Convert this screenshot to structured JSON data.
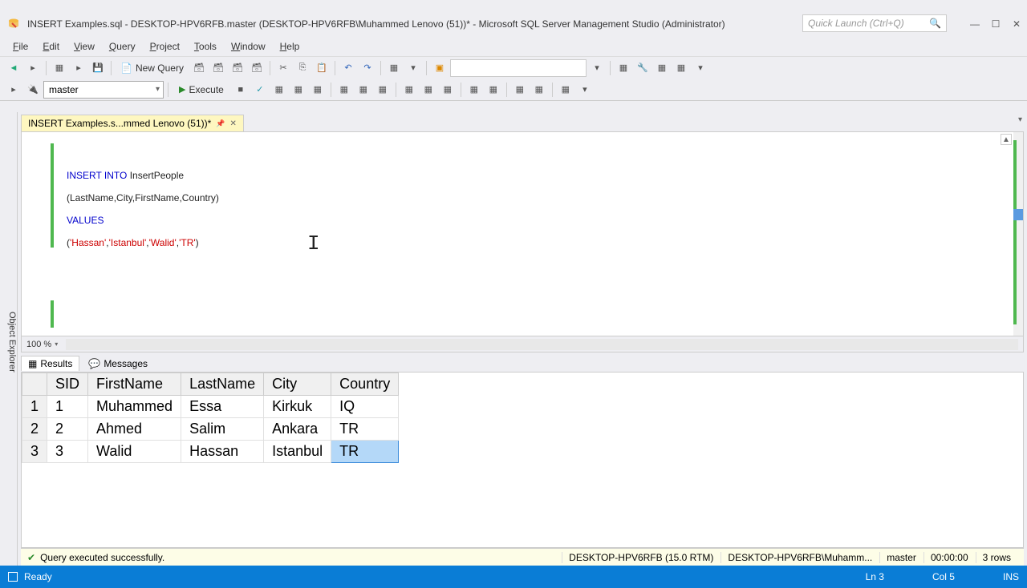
{
  "window": {
    "title": "INSERT Examples.sql - DESKTOP-HPV6RFB.master (DESKTOP-HPV6RFB\\Muhammed Lenovo (51))* - Microsoft SQL Server Management Studio (Administrator)",
    "quick_launch_placeholder": "Quick Launch (Ctrl+Q)"
  },
  "menu": {
    "file": "File",
    "edit": "Edit",
    "view": "View",
    "query": "Query",
    "project": "Project",
    "tools": "Tools",
    "window": "Window",
    "help": "Help"
  },
  "toolbar": {
    "new_query": "New Query",
    "database": "master",
    "execute": "Execute"
  },
  "object_explorer": {
    "label": "Object Explorer"
  },
  "tab": {
    "title": "INSERT Examples.s...mmed Lenovo (51))*"
  },
  "sql": {
    "insert_into": "INSERT INTO",
    "table": " InsertPeople",
    "cols": "(LastName,City,FirstName,Country)",
    "values_kw": "VALUES",
    "vals_open": "(",
    "v1": "'Hassan'",
    "c1": ",",
    "v2": "'Istanbul'",
    "c2": ",",
    "v3": "'Walid'",
    "c3": ",",
    "v4": "'TR'",
    "vals_close": ")"
  },
  "zoom": "100 %",
  "result_tabs": {
    "results": "Results",
    "messages": "Messages"
  },
  "grid": {
    "headers": {
      "sid": "SID",
      "fn": "FirstName",
      "ln": "LastName",
      "city": "City",
      "country": "Country"
    },
    "rows": [
      {
        "n": "1",
        "sid": "1",
        "fn": "Muhammed",
        "ln": "Essa",
        "city": "Kirkuk",
        "country": "IQ"
      },
      {
        "n": "2",
        "sid": "2",
        "fn": "Ahmed",
        "ln": "Salim",
        "city": "Ankara",
        "country": "TR"
      },
      {
        "n": "3",
        "sid": "3",
        "fn": "Walid",
        "ln": "Hassan",
        "city": "Istanbul",
        "country": "TR"
      }
    ]
  },
  "messages": {
    "success": "Query executed successfully.",
    "server": "DESKTOP-HPV6RFB (15.0 RTM)",
    "user": "DESKTOP-HPV6RFB\\Muhamm...",
    "db": "master",
    "time": "00:00:00",
    "rows": "3 rows"
  },
  "status": {
    "ready": "Ready",
    "line": "Ln 3",
    "col": "Col 5",
    "ins": "INS"
  }
}
